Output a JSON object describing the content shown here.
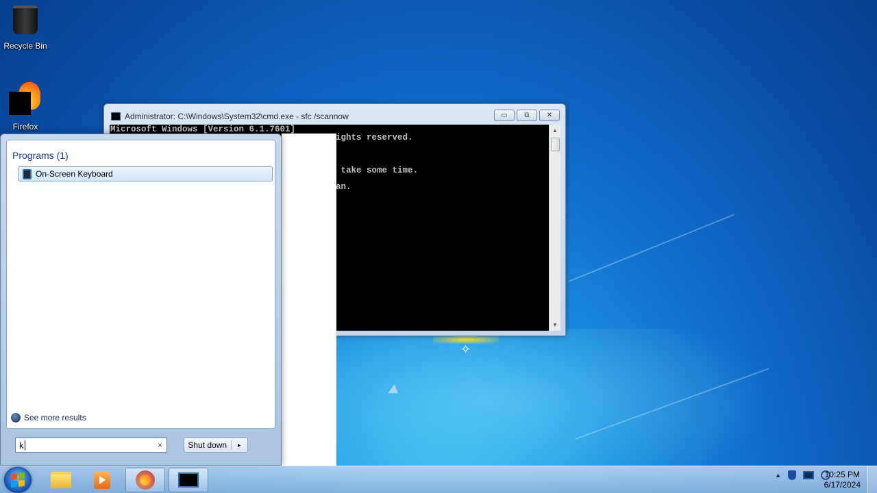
{
  "desktop": {
    "icons": [
      {
        "label": "Recycle Bin",
        "icon": "recycle-bin-icon"
      },
      {
        "label": "Firefox",
        "icon": "firefox-icon"
      }
    ]
  },
  "cmd_window": {
    "title": "Administrator: C:\\Windows\\System32\\cmd.exe - sfc  /scannow",
    "lines": [
      "Microsoft Windows [Version 6.1.7601]",
      "ights reserved.",
      " take some time.",
      "an."
    ],
    "buttons": {
      "minimize": "▭",
      "maximize": "⧉",
      "close": "✕"
    }
  },
  "start_menu": {
    "section_title": "Programs (1)",
    "program_item": "On-Screen Keyboard",
    "see_more": "See more results",
    "search_value": "k",
    "clear_glyph": "×",
    "shutdown_label": "Shut down",
    "shutdown_arrow": "▸"
  },
  "taskbar": {
    "clock_time": "10:25 PM",
    "clock_date": "6/17/2024",
    "tray_up_arrow": "▲"
  }
}
